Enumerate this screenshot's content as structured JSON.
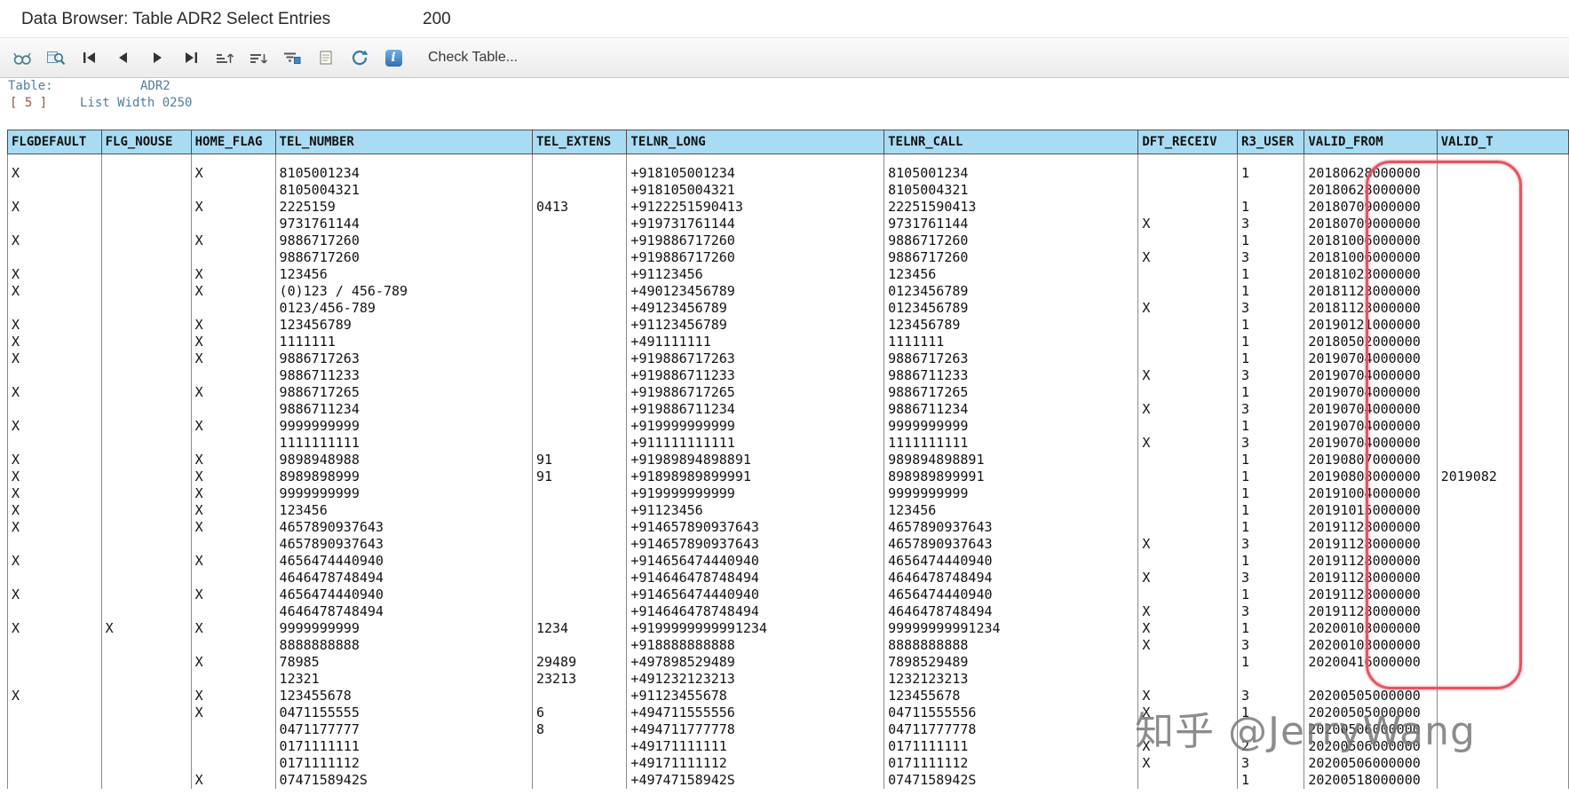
{
  "colors": {
    "header_bg": "#a8dcf4",
    "highlight": "#e25563",
    "label_color": "#4f7e9b",
    "grid_line": "#8a8a8a"
  },
  "header": {
    "title": "Data Browser: Table ADR2 Select Entries",
    "count": "200"
  },
  "toolbar": {
    "icons": [
      "display-icon",
      "find-icon",
      "first-page-icon",
      "previous-page-icon",
      "next-page-icon",
      "last-page-icon",
      "sort-ascending-icon",
      "sort-descending-icon",
      "filter-icon",
      "print-icon",
      "refresh-icon",
      "info-icon"
    ],
    "check_table_label": "Check Table..."
  },
  "info": {
    "table_label": "Table:",
    "table_name": "ADR2",
    "fixed_columns": "[ 5 ]",
    "list_width_label": "List Width 0250"
  },
  "table": {
    "columns": [
      "FLGDEFAULT",
      "FLG_NOUSE",
      "HOME_FLAG",
      "TEL_NUMBER",
      "TEL_EXTENS",
      "TELNR_LONG",
      "TELNR_CALL",
      "DFT_RECEIV",
      "R3_USER",
      "VALID_FROM",
      "VALID_T"
    ],
    "rows": [
      [
        "X",
        "",
        "X",
        "8105001234",
        "",
        "+918105001234",
        "8105001234",
        "",
        "1",
        "20180628000000",
        ""
      ],
      [
        "",
        "",
        "",
        "8105004321",
        "",
        "+918105004321",
        "8105004321",
        "",
        "",
        "20180628000000",
        ""
      ],
      [
        "X",
        "",
        "X",
        "2225159",
        "0413",
        "+9122251590413",
        "22251590413",
        "",
        "1",
        "20180709000000",
        ""
      ],
      [
        "",
        "",
        "",
        "9731761144",
        "",
        "+919731761144",
        "9731761144",
        "X",
        "3",
        "20180709000000",
        ""
      ],
      [
        "X",
        "",
        "X",
        "9886717260",
        "",
        "+919886717260",
        "9886717260",
        "",
        "1",
        "20181006000000",
        ""
      ],
      [
        "",
        "",
        "",
        "9886717260",
        "",
        "+919886717260",
        "9886717260",
        "X",
        "3",
        "20181006000000",
        ""
      ],
      [
        "X",
        "",
        "X",
        "123456",
        "",
        "+91123456",
        "123456",
        "",
        "1",
        "20181023000000",
        ""
      ],
      [
        "X",
        "",
        "X",
        "(0)123 / 456-789",
        "",
        "+490123456789",
        "0123456789",
        "",
        "1",
        "20181123000000",
        ""
      ],
      [
        "",
        "",
        "",
        "0123/456-789",
        "",
        "+49123456789",
        "0123456789",
        "X",
        "3",
        "20181123000000",
        ""
      ],
      [
        "X",
        "",
        "X",
        "123456789",
        "",
        "+91123456789",
        "123456789",
        "",
        "1",
        "20190121000000",
        ""
      ],
      [
        "X",
        "",
        "X",
        "1111111",
        "",
        "+491111111",
        "1111111",
        "",
        "1",
        "20180502000000",
        ""
      ],
      [
        "X",
        "",
        "X",
        "9886717263",
        "",
        "+919886717263",
        "9886717263",
        "",
        "1",
        "20190704000000",
        ""
      ],
      [
        "",
        "",
        "",
        "9886711233",
        "",
        "+919886711233",
        "9886711233",
        "X",
        "3",
        "20190704000000",
        ""
      ],
      [
        "X",
        "",
        "X",
        "9886717265",
        "",
        "+919886717265",
        "9886717265",
        "",
        "1",
        "20190704000000",
        ""
      ],
      [
        "",
        "",
        "",
        "9886711234",
        "",
        "+919886711234",
        "9886711234",
        "X",
        "3",
        "20190704000000",
        ""
      ],
      [
        "X",
        "",
        "X",
        "9999999999",
        "",
        "+919999999999",
        "9999999999",
        "",
        "1",
        "20190704000000",
        ""
      ],
      [
        "",
        "",
        "",
        "1111111111",
        "",
        "+911111111111",
        "1111111111",
        "X",
        "3",
        "20190704000000",
        ""
      ],
      [
        "X",
        "",
        "X",
        "9898948988",
        "91",
        "+91989894898891",
        "989894898891",
        "",
        "1",
        "20190807000000",
        ""
      ],
      [
        "X",
        "",
        "X",
        "8989898999",
        "91",
        "+91898989899991",
        "898989899991",
        "",
        "1",
        "20190808000000",
        "2019082"
      ],
      [
        "X",
        "",
        "X",
        "9999999999",
        "",
        "+919999999999",
        "9999999999",
        "",
        "1",
        "20191004000000",
        ""
      ],
      [
        "X",
        "",
        "X",
        "123456",
        "",
        "+91123456",
        "123456",
        "",
        "1",
        "20191015000000",
        ""
      ],
      [
        "X",
        "",
        "X",
        "4657890937643",
        "",
        "+914657890937643",
        "4657890937643",
        "",
        "1",
        "20191128000000",
        ""
      ],
      [
        "",
        "",
        "",
        "4657890937643",
        "",
        "+914657890937643",
        "4657890937643",
        "X",
        "3",
        "20191128000000",
        ""
      ],
      [
        "X",
        "",
        "X",
        "4656474440940",
        "",
        "+914656474440940",
        "4656474440940",
        "",
        "1",
        "20191128000000",
        ""
      ],
      [
        "",
        "",
        "",
        "4646478748494",
        "",
        "+914646478748494",
        "4646478748494",
        "X",
        "3",
        "20191128000000",
        ""
      ],
      [
        "X",
        "",
        "X",
        "4656474440940",
        "",
        "+914656474440940",
        "4656474440940",
        "",
        "1",
        "20191128000000",
        ""
      ],
      [
        "",
        "",
        "",
        "4646478748494",
        "",
        "+914646478748494",
        "4646478748494",
        "X",
        "3",
        "20191128000000",
        ""
      ],
      [
        "X",
        "X",
        "X",
        "9999999999",
        "1234",
        "+9199999999991234",
        "99999999991234",
        "X",
        "1",
        "20200103000000",
        ""
      ],
      [
        "",
        "",
        "",
        "8888888888",
        "",
        "+918888888888",
        "8888888888",
        "X",
        "3",
        "20200103000000",
        ""
      ],
      [
        "",
        "",
        "X",
        "78985",
        "29489",
        "+497898529489",
        "7898529489",
        "",
        "1",
        "20200416000000",
        ""
      ],
      [
        "",
        "",
        "",
        "12321",
        "23213",
        "+491232123213",
        "1232123213",
        "",
        "",
        "",
        ""
      ],
      [
        "X",
        "",
        "X",
        "123455678",
        "",
        "+91123455678",
        "123455678",
        "X",
        "3",
        "20200505000000",
        ""
      ],
      [
        "",
        "",
        "X",
        "0471155555",
        "6",
        "+494711555556",
        "04711555556",
        "X",
        "1",
        "20200505000000",
        ""
      ],
      [
        "",
        "",
        "",
        "0471177777",
        "8",
        "+494711777778",
        "04711777778",
        "",
        "",
        "20200506000000",
        ""
      ],
      [
        "",
        "",
        "",
        "0171111111",
        "",
        "+49171111111",
        "0171111111",
        "X",
        "2",
        "20200506000000",
        ""
      ],
      [
        "",
        "",
        "",
        "0171111112",
        "",
        "+49171111112",
        "0171111112",
        "X",
        "3",
        "20200506000000",
        ""
      ],
      [
        "",
        "",
        "X",
        "0747158942S",
        "",
        "+49747158942S",
        "0747158942S",
        "",
        "1",
        "20200518000000",
        ""
      ]
    ]
  },
  "annotation": {
    "highlighted_column": "VALID_FROM"
  },
  "watermark": "知乎 @JerryWang"
}
